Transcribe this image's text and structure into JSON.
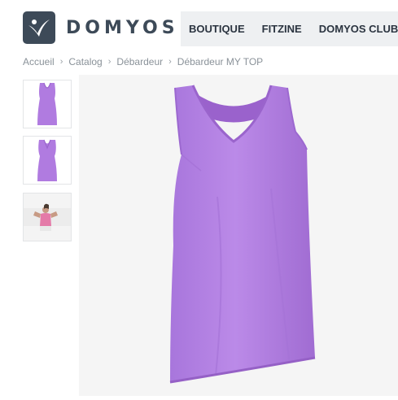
{
  "brand": {
    "name": "DOMYOS",
    "logo_color": "#3d4a58"
  },
  "nav": {
    "items": [
      {
        "label": "BOUTIQUE"
      },
      {
        "label": "FITZINE"
      },
      {
        "label": "DOMYOS CLUB"
      }
    ]
  },
  "breadcrumb": {
    "items": [
      {
        "label": "Accueil"
      },
      {
        "label": "Catalog"
      },
      {
        "label": "Débardeur"
      },
      {
        "label": "Débardeur MY TOP"
      }
    ],
    "separator": "›"
  },
  "product": {
    "color": "#b07be0",
    "thumbnails": [
      {
        "icon": "tank-top-front-thumbnail"
      },
      {
        "icon": "tank-top-back-thumbnail"
      },
      {
        "icon": "model-photo-thumbnail"
      }
    ],
    "main_image_icon": "purple-tank-top-image"
  }
}
